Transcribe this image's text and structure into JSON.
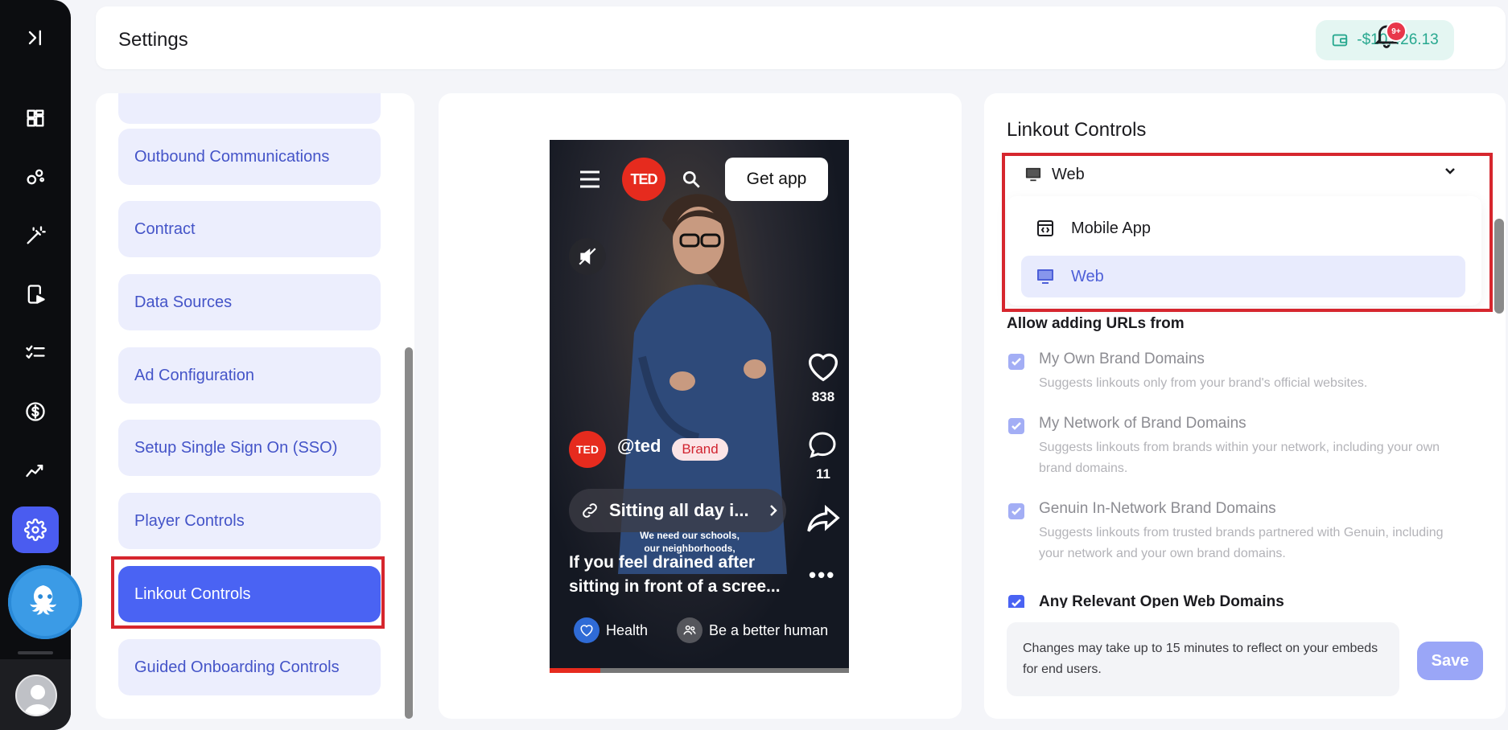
{
  "header": {
    "title": "Settings",
    "balance": "-$10,426.13",
    "notification_badge": "9+"
  },
  "rail": {
    "icons": [
      "sidebar-toggle-icon",
      "dashboard-icon",
      "network-icon",
      "magic-wand-icon",
      "video-player-icon",
      "checklist-icon",
      "dollar-icon",
      "analytics-icon",
      "settings-icon"
    ],
    "active_icon": "settings-icon"
  },
  "settings_nav": {
    "items": [
      {
        "label": "Outbound Communications"
      },
      {
        "label": "Contract"
      },
      {
        "label": "Data Sources"
      },
      {
        "label": "Ad Configuration"
      },
      {
        "label": "Setup Single Sign On (SSO)"
      },
      {
        "label": "Player Controls"
      },
      {
        "label": "Linkout Controls",
        "active": true
      },
      {
        "label": "Guided Onboarding Controls"
      }
    ]
  },
  "preview": {
    "get_app": "Get app",
    "ted_logo": "TED",
    "likes": "838",
    "comments": "11",
    "handle": "@ted",
    "brand_tag": "Brand",
    "link_title": "Sitting all day i...",
    "overlay_text": "We need our schools, our neighborhoods,",
    "caption_line1": "If you feel drained after",
    "caption_line2": "sitting in front of a scree...",
    "chips": [
      {
        "label": "Health"
      },
      {
        "label": "Be a better human"
      }
    ]
  },
  "linkout": {
    "title": "Linkout Controls",
    "select_value": "Web",
    "options": [
      {
        "label": "Mobile App",
        "icon": "code-window-icon"
      },
      {
        "label": "Web",
        "icon": "monitor-icon",
        "selected": true
      }
    ],
    "allow_title": "Allow adding URLs from",
    "checkboxes": [
      {
        "label": "My Own Brand Domains",
        "desc": "Suggests linkouts only from your brand's official websites.",
        "checked": true,
        "disabled": true
      },
      {
        "label": "My Network of Brand Domains",
        "desc": "Suggests linkouts from brands within your network, including your own brand domains.",
        "checked": true,
        "disabled": true
      },
      {
        "label": "Genuin In-Network Brand Domains",
        "desc": "Suggests linkouts from trusted brands partnered with Genuin, including your network and your own brand domains.",
        "checked": true,
        "disabled": true
      },
      {
        "label": "Any Relevant Open Web Domains",
        "checked": true,
        "disabled": false
      }
    ],
    "notice": "Changes may take up to 15 minutes to reflect on your embeds for end users.",
    "save_label": "Save"
  },
  "colors": {
    "accent": "#4a63f3",
    "nav_bg": "#eceefd",
    "nav_text": "#4454c8",
    "balance_text": "#27a88f",
    "highlight": "#d6262e",
    "ted_red": "#e62b1e"
  }
}
